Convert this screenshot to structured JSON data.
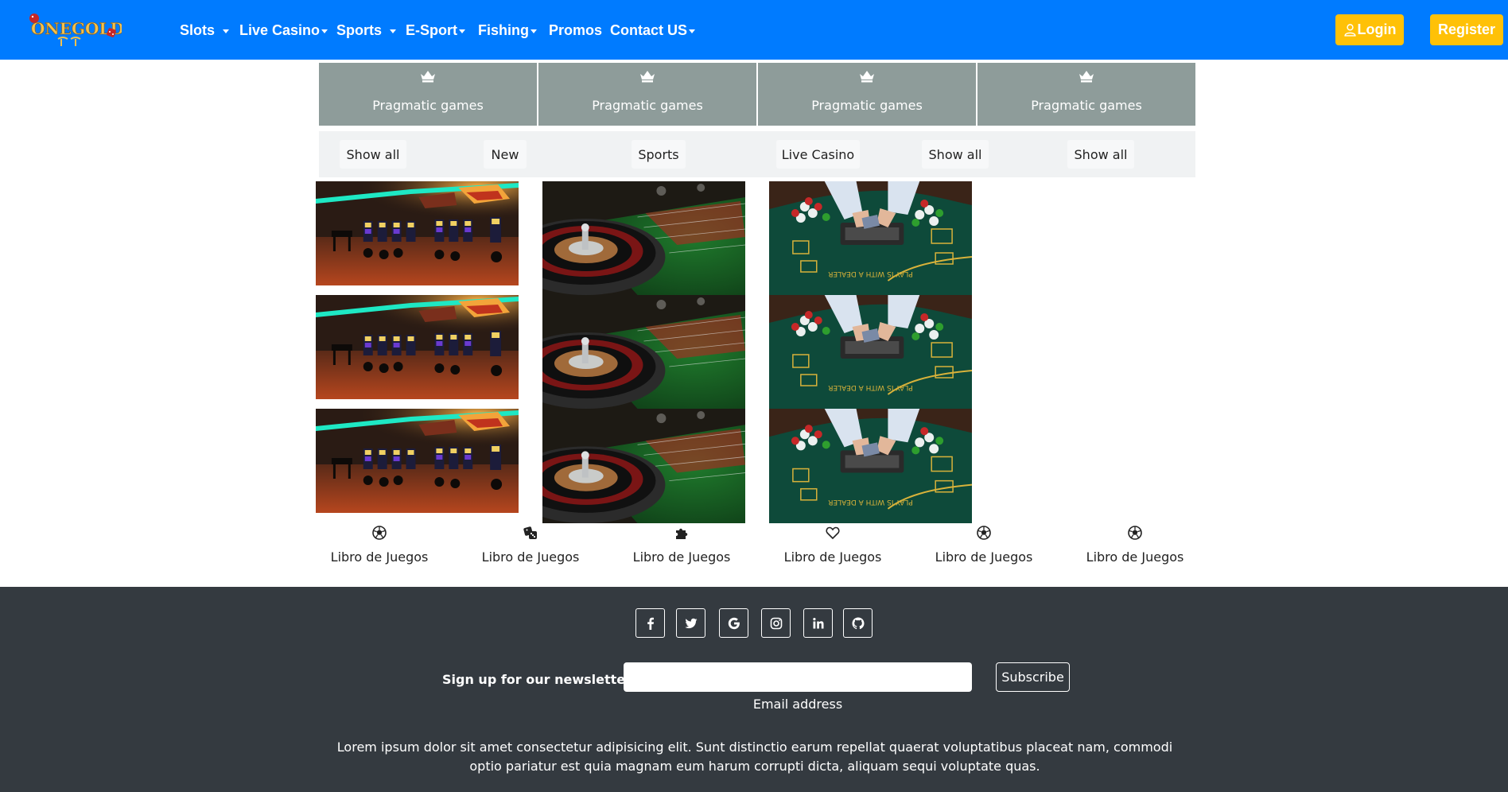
{
  "brand": {
    "logo_text": "ONEGOLD",
    "colors": {
      "primary": "#007bff",
      "warning": "#ffc107",
      "card": "#8e9c9a",
      "footer": "#343a40"
    }
  },
  "nav": {
    "items": [
      {
        "label": "Slots",
        "has_dropdown": true
      },
      {
        "label": "Live Casino",
        "has_dropdown": true
      },
      {
        "label": "Sports",
        "has_dropdown": true
      },
      {
        "label": "E-Sport",
        "has_dropdown": true
      },
      {
        "label": "Fishing",
        "has_dropdown": true
      },
      {
        "label": "Promos",
        "has_dropdown": false
      },
      {
        "label": "Contact US",
        "has_dropdown": true
      }
    ],
    "login_label": "Login",
    "register_label": "Register"
  },
  "categories": [
    {
      "icon": "crown-icon",
      "label": "Pragmatic games"
    },
    {
      "icon": "crown-icon",
      "label": "Pragmatic games"
    },
    {
      "icon": "crown-icon",
      "label": "Pragmatic games"
    },
    {
      "icon": "crown-icon",
      "label": "Pragmatic games"
    }
  ],
  "filters": [
    "Show all",
    "New",
    "Sports",
    "Live Casino",
    "Show all",
    "Show all"
  ],
  "games": {
    "columns": [
      {
        "image": "casino-hall",
        "count": 3
      },
      {
        "image": "roulette-table",
        "count": 3
      },
      {
        "image": "poker-table",
        "count": 3
      }
    ]
  },
  "game_links": [
    {
      "icon": "soccer-ball-icon",
      "label": "Libro de Juegos"
    },
    {
      "icon": "dice-icon",
      "label": "Libro de Juegos"
    },
    {
      "icon": "puzzle-icon",
      "label": "Libro de Juegos"
    },
    {
      "icon": "heart-icon",
      "label": "Libro de Juegos"
    },
    {
      "icon": "soccer-ball-icon",
      "label": "Libro de Juegos"
    },
    {
      "icon": "soccer-ball-icon",
      "label": "Libro de Juegos"
    }
  ],
  "footer": {
    "social": [
      "facebook-icon",
      "twitter-icon",
      "google-icon",
      "instagram-icon",
      "linkedin-icon",
      "github-icon"
    ],
    "newsletter_label": "Sign up for our newsletter",
    "email_value": "",
    "email_hint": "Email address",
    "subscribe_label": "Subscribe",
    "lorem": "Lorem ipsum dolor sit amet consectetur adipisicing elit. Sunt distinctio earum repellat quaerat voluptatibus placeat nam, commodi optio pariatur est quia magnam eum harum corrupti dicta, aliquam sequi voluptate quas."
  }
}
